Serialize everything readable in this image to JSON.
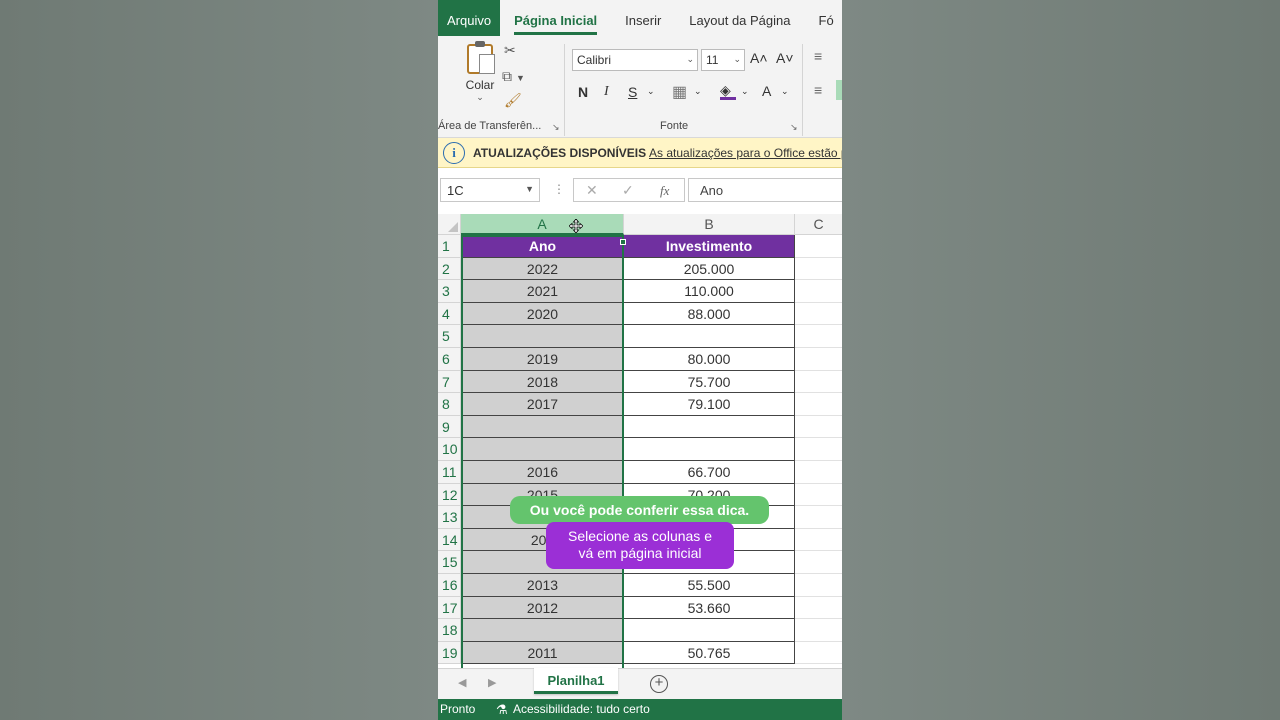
{
  "ribbon": {
    "tabs": [
      "Arquivo",
      "Página Inicial",
      "Inserir",
      "Layout da Página",
      "Fó"
    ],
    "paste_label": "Colar",
    "clipboard_group": "Área de Transferên...",
    "font_group": "Fonte",
    "font_name": "Calibri",
    "font_size": "11",
    "grow_font": "A˄",
    "shrink_font": "A˅",
    "bold": "N",
    "italic": "I",
    "underline": "S",
    "font_color": "A"
  },
  "infobar": {
    "title": "ATUALIZAÇÕES DISPONÍVEIS",
    "message": "As atualizações para o Office estão p"
  },
  "formula_bar": {
    "name_box": "1C",
    "formula": "Ano",
    "fx_label": "fx"
  },
  "grid": {
    "columns": [
      "A",
      "B",
      "C"
    ],
    "header": {
      "a": "Ano",
      "b": "Investimento"
    },
    "rows": [
      {
        "n": "2",
        "a": "2022",
        "b": "205.000"
      },
      {
        "n": "3",
        "a": "2021",
        "b": "110.000"
      },
      {
        "n": "4",
        "a": "2020",
        "b": "88.000"
      },
      {
        "n": "5",
        "a": "",
        "b": ""
      },
      {
        "n": "6",
        "a": "2019",
        "b": "80.000"
      },
      {
        "n": "7",
        "a": "2018",
        "b": "75.700"
      },
      {
        "n": "8",
        "a": "2017",
        "b": "79.100"
      },
      {
        "n": "9",
        "a": "",
        "b": ""
      },
      {
        "n": "10",
        "a": "",
        "b": ""
      },
      {
        "n": "11",
        "a": "2016",
        "b": "66.700"
      },
      {
        "n": "12",
        "a": "2015",
        "b": "70.200"
      },
      {
        "n": "13",
        "a": "",
        "b": ""
      },
      {
        "n": "14",
        "a": "201",
        "b": ""
      },
      {
        "n": "15",
        "a": "",
        "b": ""
      },
      {
        "n": "16",
        "a": "2013",
        "b": "55.500"
      },
      {
        "n": "17",
        "a": "2012",
        "b": "53.660"
      },
      {
        "n": "18",
        "a": "",
        "b": ""
      },
      {
        "n": "19",
        "a": "2011",
        "b": "50.765"
      }
    ]
  },
  "captions": {
    "line1": "Ou você pode conferir essa dica.",
    "line2a": "Selecione as colunas e",
    "line2b": "vá em página inicial"
  },
  "sheet_tabs": [
    "Planilha1"
  ],
  "status": {
    "ready": "Pronto",
    "accessibility": "Acessibilidade: tudo certo"
  },
  "colors": {
    "excel_green": "#217346",
    "header_purple": "#7030a0",
    "caption_green": "#64c46d",
    "caption_purple": "#9b2fd6"
  }
}
